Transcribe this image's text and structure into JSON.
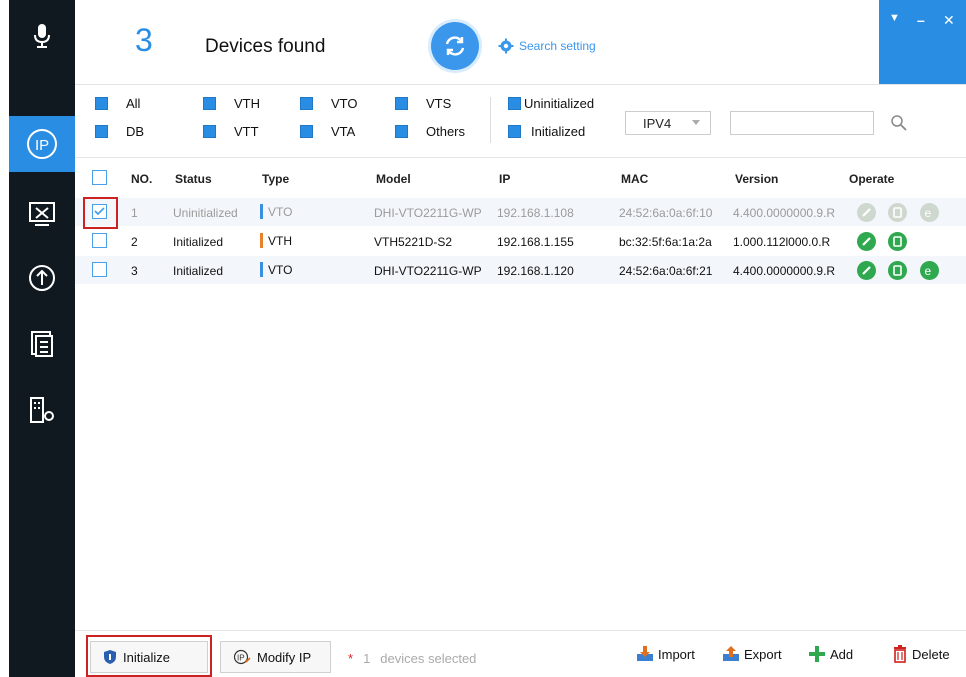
{
  "header": {
    "count": "3",
    "found_label": "Devices found",
    "search_setting": "Search setting"
  },
  "sidebar": {
    "items": [
      {
        "icon": "microphone-icon"
      },
      {
        "icon": "ip-search-icon",
        "active": true
      },
      {
        "icon": "tools-icon"
      },
      {
        "icon": "upgrade-icon"
      },
      {
        "icon": "document-list-icon"
      },
      {
        "icon": "building-settings-icon"
      }
    ]
  },
  "filters": {
    "row1": [
      "All",
      "VTH",
      "VTO",
      "VTS",
      "Uninitialized"
    ],
    "row2": [
      "DB",
      "VTT",
      "VTA",
      "Others",
      "Initialized"
    ],
    "ip_version": "IPV4",
    "search_value": ""
  },
  "table": {
    "headers": [
      "NO.",
      "Status",
      "Type",
      "Model",
      "IP",
      "MAC",
      "Version",
      "Operate"
    ],
    "rows": [
      {
        "no": "1",
        "status": "Uninitialized",
        "type": "VTO",
        "model": "DHI-VTO2211G-WP",
        "ip": "192.168.1.108",
        "mac": "24:52:6a:0a:6f:10",
        "version": "4.400.0000000.9.R",
        "checked": true,
        "type_color": "#3a8fe0"
      },
      {
        "no": "2",
        "status": "Initialized",
        "type": "VTH",
        "model": "VTH5221D-S2",
        "ip": "192.168.1.155",
        "mac": "bc:32:5f:6a:1a:2a",
        "version": "1.000.112l000.0.R",
        "checked": false,
        "type_color": "#e8822a"
      },
      {
        "no": "3",
        "status": "Initialized",
        "type": "VTO",
        "model": "DHI-VTO2211G-WP",
        "ip": "192.168.1.120",
        "mac": "24:52:6a:0a:6f:21",
        "version": "4.400.0000000.9.R",
        "checked": false,
        "type_color": "#3a8fe0"
      }
    ]
  },
  "footer": {
    "initialize": "Initialize",
    "modify_ip": "Modify IP",
    "selected_count": "1",
    "selected_label": "devices selected",
    "import": "Import",
    "export": "Export",
    "add": "Add",
    "delete": "Delete"
  },
  "colors": {
    "accent": "#2a8de4",
    "sidebar_bg": "#101820",
    "operate_green": "#2fa84f",
    "highlight_red": "#cc2222"
  }
}
